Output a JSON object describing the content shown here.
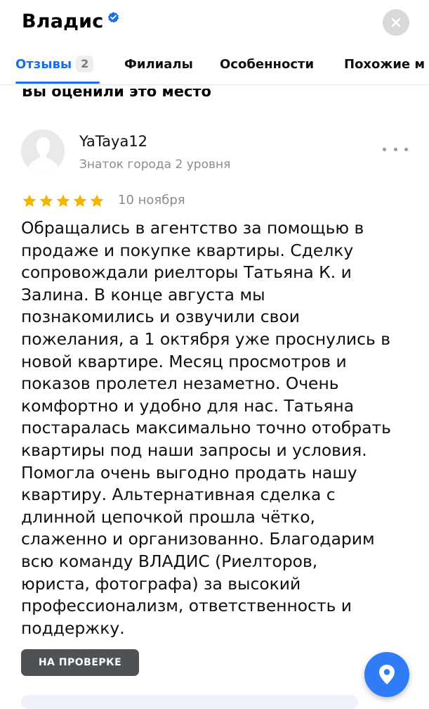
{
  "header": {
    "title": "Владис"
  },
  "tabs": [
    {
      "label": "Отзывы",
      "badge": "2"
    },
    {
      "label": "Филиалы"
    },
    {
      "label": "Особенности"
    },
    {
      "label": "Похожие м"
    }
  ],
  "section": {
    "cut_heading": "Вы оценили это место"
  },
  "review": {
    "author": "YaTaya12",
    "author_level": "Знаток города 2 уровня",
    "rating": 5,
    "date": "10 ноября",
    "lines": [
      "Обращались в агентство за помощью в",
      "продаже и покупке квартиры. Сделку",
      "сопровождали риелторы Татьяна К. и",
      "Залина. В конце августа мы",
      "познакомились и озвучили свои",
      "пожелания, а 1 октября уже проснулись в",
      "новой квартире. Месяц просмотров и",
      "показов пролетел незаметно. Очень",
      "комфортно и удобно для нас. Татьяна",
      "постаралась максимально точно отобрать",
      "квартиры под наши запросы и условия.",
      "Помогла очень выгодно продать нашу",
      "квартиру. Альтернативная сделка с",
      "длинной цепочкой прошла чётко,",
      "слаженно и организованно. Благодарим",
      "всю команду ВЛАДИС (Риелторов,",
      "юриста, фотографа) за высокий",
      "профессионализм, ответственность и",
      "поддержку."
    ],
    "status": "НА ПРОВЕРКЕ"
  },
  "colors": {
    "accent": "#1a6fe8",
    "star": "#f5b400",
    "fab": "#2f7cf6",
    "badge_bg": "#4f5254"
  },
  "icons": {
    "verified": "verified-check-icon",
    "close": "close-icon",
    "more": "more-dots-icon",
    "location": "location-pin-icon"
  }
}
